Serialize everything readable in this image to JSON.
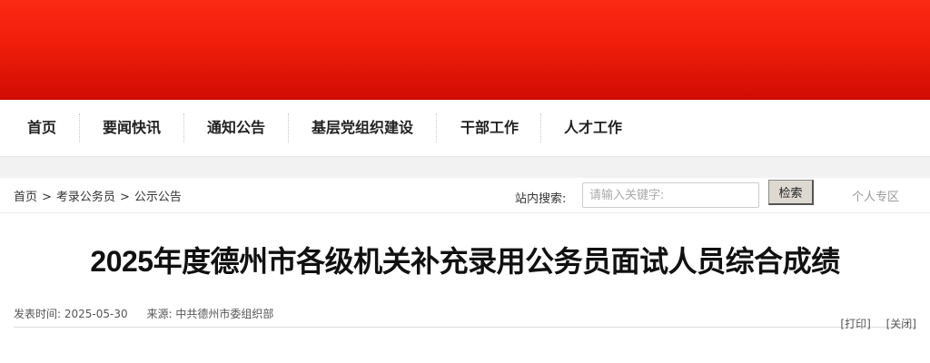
{
  "nav": {
    "items": [
      {
        "label": "首页"
      },
      {
        "label": "要闻快讯"
      },
      {
        "label": "通知公告"
      },
      {
        "label": "基层党组织建设"
      },
      {
        "label": "干部工作"
      },
      {
        "label": "人才工作"
      }
    ]
  },
  "breadcrumb": {
    "items": [
      "首页",
      "考录公务员",
      "公示公告"
    ],
    "separator": ">"
  },
  "search": {
    "label": "站内搜索:",
    "placeholder": "请输入关键字:",
    "value": "",
    "button_label": "检索"
  },
  "personal_zone": "个人专区",
  "article": {
    "title": "2025年度德州市各级机关补充录用公务员面试人员综合成绩",
    "publish_label": "发表时间:",
    "publish_date": "2025-05-30",
    "source_label": "来源:",
    "source": "中共德州市委组织部",
    "print_label": "[打印]",
    "close_label": "[关闭]"
  },
  "colors": {
    "banner_top": "#fb2a14",
    "banner_bottom": "#d10c03"
  }
}
